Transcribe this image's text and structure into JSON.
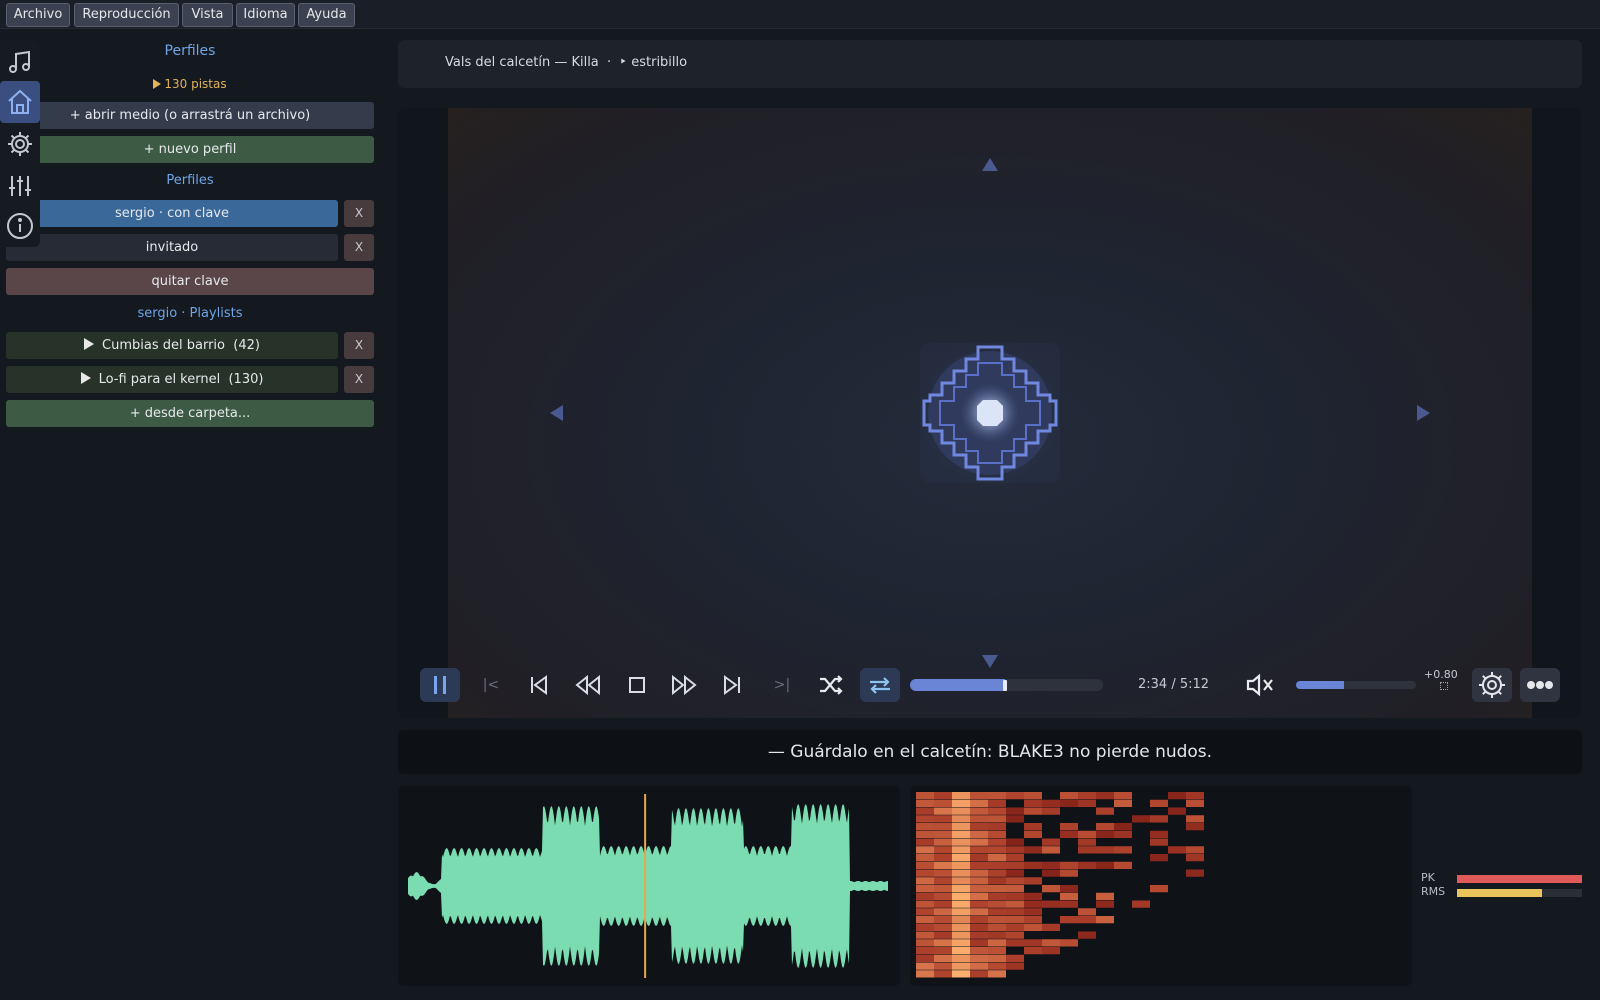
{
  "menu": {
    "items": [
      "Archivo",
      "Reproducción",
      "Vista",
      "Idioma",
      "Ayuda"
    ]
  },
  "rail": {
    "icons": [
      "music-note-icon",
      "home-icon",
      "gear-icon",
      "sliders-icon",
      "info-icon"
    ],
    "active": "home-icon"
  },
  "sidebar": {
    "title": "Perfiles",
    "tracks": "130 pistas",
    "open_media": "+ abrir medio (o arrastrá un archivo)",
    "new_profile": "+ nuevo perfil",
    "profiles_heading": "Perfiles",
    "profiles": [
      {
        "label": "sergio · con clave",
        "remove": "X"
      },
      {
        "label": "invitado",
        "remove": "X"
      }
    ],
    "remove_key": "quitar clave",
    "playlists_heading": "sergio · Playlists",
    "playlists": [
      {
        "label": "Cumbias del barrio  (42)",
        "remove": "X"
      },
      {
        "label": "Lo-fi para el kernel  (130)",
        "remove": "X"
      }
    ],
    "from_folder": "+ desde carpeta..."
  },
  "now_playing": {
    "text": "Vals del calcetín — Killa  ·  ‣ estribillo"
  },
  "controls": {
    "time": "2:34 / 5:12",
    "progress": 0.494,
    "volume": 0.4,
    "gain": "+0.80",
    "shuffle": false,
    "repeat": true,
    "muted": true,
    "playing": true,
    "loop_a_label": "|<",
    "loop_b_label": ">|"
  },
  "quote": {
    "text": "— Guárdalo en el calcetín: BLAKE3 no pierde nudos."
  },
  "meters": {
    "pk_label": "PK",
    "rms_label": "RMS",
    "pk": 1.0,
    "rms": 0.68
  },
  "colors": {
    "accent": "#6a84d6",
    "waveform": "#7adcb0",
    "playhead": "#e8a84a",
    "pk": "#e05a5a",
    "rms": "#e8c45a"
  }
}
